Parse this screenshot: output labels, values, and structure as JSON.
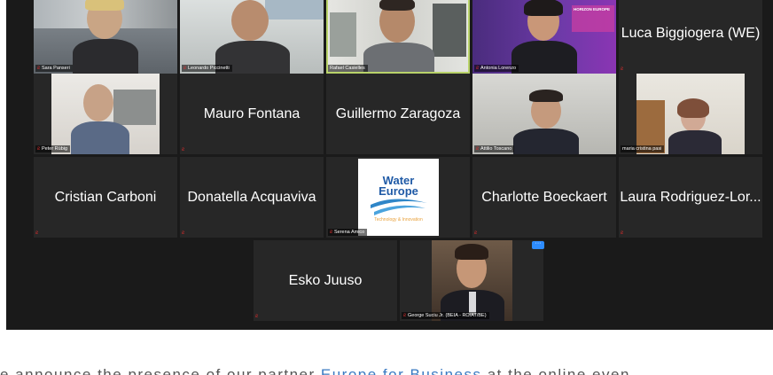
{
  "participants": {
    "sara_panseri": "Sara Panseri",
    "leonardo_piccinetti": "Leonardo Piccinetti",
    "rafael_casielles": "Rafael Casielles",
    "antonia_lorenzo": "Antonia Lorenzo",
    "luca_biggiogera": "Luca Biggiogera (WE)",
    "peter_rubig": "Peter Rübig",
    "mauro_fontana": "Mauro Fontana",
    "guillermo_zaragoza": "Guillermo Zaragoza",
    "attilio_toscano": "Attilio Toscano",
    "maria_cristina_pasi": "maria cristina pasi",
    "cristian_carboni": "Cristian Carboni",
    "donatella_acquaviva": "Donatella Acquaviva",
    "serena_amico": "Serena Amico",
    "charlotte_boeckaert": "Charlotte Boeckaert",
    "laura_rodriguez": "Laura Rodriguez-Lor...",
    "esko_juuso": "Esko Juuso",
    "george_suciu": "George Suciu Jr. (BEIA - RO/AT/BE)"
  },
  "logo": {
    "line1": "Water",
    "line2": "Europe",
    "tagline": "Technology & Innovation"
  },
  "backdrop_text": "HORIZON EUROPE",
  "more_button": "···",
  "caption": {
    "before": "e announce the presence of our partner ",
    "link": "Europe for Business",
    "after": " at the online even"
  },
  "colors": {
    "background": "#1a1a1a",
    "tile": "#272727",
    "speaker_outline": "#b9d36a",
    "muted_mic": "#e02d2d",
    "link": "#3a7ac2"
  },
  "icons": {
    "muted": "microphone-muted-icon",
    "more": "more-options-icon"
  }
}
